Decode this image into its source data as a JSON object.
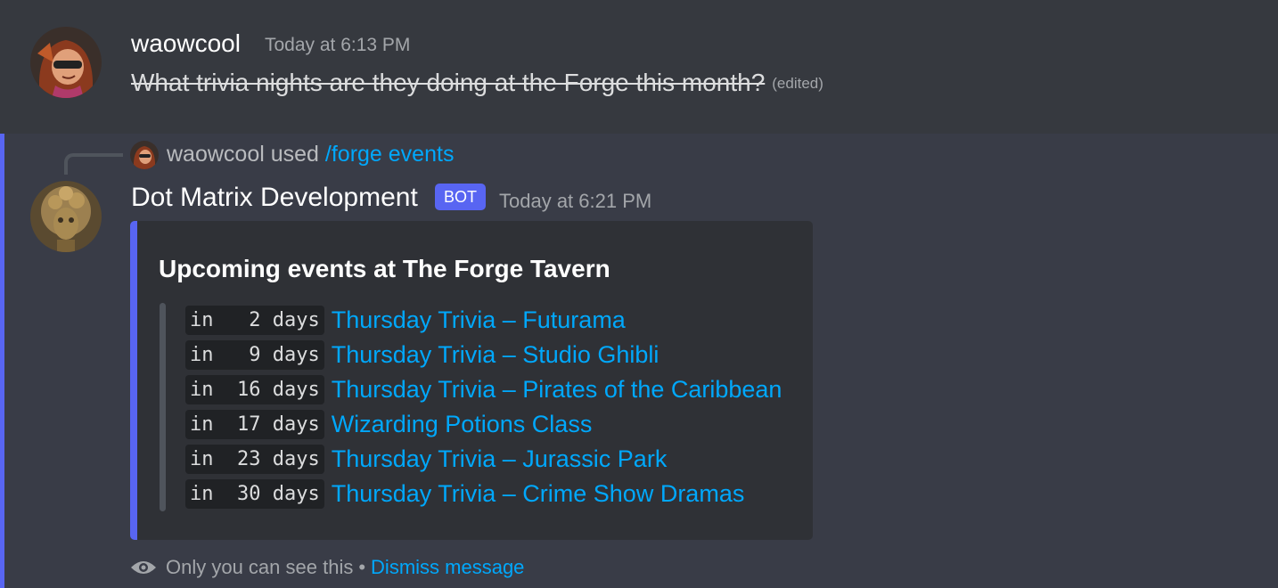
{
  "message1": {
    "username": "waowcool",
    "timestamp": "Today at 6:13 PM",
    "text": "What trivia nights are they doing at the Forge this month?",
    "edited_label": "(edited)"
  },
  "message2": {
    "reply": {
      "username": "waowcool",
      "used_label": "used",
      "command": "/forge events"
    },
    "username": "Dot Matrix Development",
    "bot_tag": "BOT",
    "timestamp": "Today at 6:21 PM",
    "embed": {
      "title": "Upcoming events at The Forge Tavern",
      "events": [
        {
          "when": "in   2 days",
          "name": "Thursday Trivia – Futurama"
        },
        {
          "when": "in   9 days",
          "name": "Thursday Trivia – Studio Ghibli"
        },
        {
          "when": "in  16 days",
          "name": "Thursday Trivia – Pirates of the Caribbean"
        },
        {
          "when": "in  17 days",
          "name": "Wizarding Potions Class"
        },
        {
          "when": "in  23 days",
          "name": "Thursday Trivia – Jurassic Park"
        },
        {
          "when": "in  30 days",
          "name": "Thursday Trivia – Crime Show Dramas"
        }
      ]
    },
    "footer": {
      "notice": "Only you can see this",
      "separator": "•",
      "dismiss": "Dismiss message"
    }
  },
  "colors": {
    "background": "#36393f",
    "ephemeral_background": "#393c47",
    "accent": "#5865f2",
    "link": "#00a8fc",
    "embed_background": "#2f3136"
  },
  "icons": {
    "footer_icon": "eye-icon"
  }
}
